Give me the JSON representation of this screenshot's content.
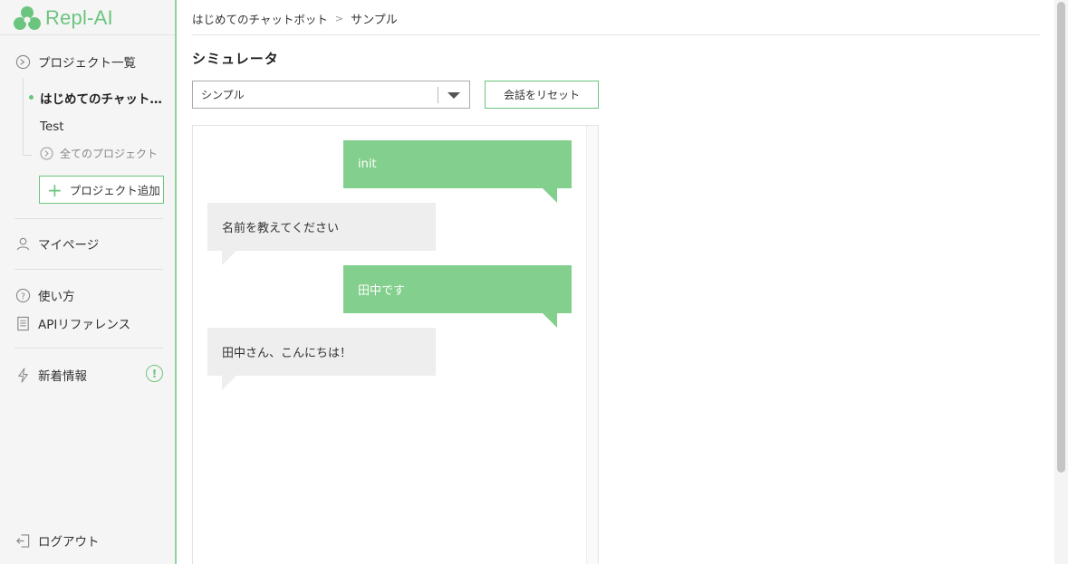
{
  "app": {
    "logo_text": "Repl-AI",
    "accent_color": "#6cc57e"
  },
  "sidebar": {
    "project_list_label": "プロジェクト一覧",
    "projects": [
      {
        "label": "はじめてのチャット…",
        "active": true
      },
      {
        "label": "Test",
        "active": false
      }
    ],
    "all_projects_label": "全てのプロジェクト",
    "add_project_label": "プロジェクト追加",
    "mypage_label": "マイページ",
    "howto_label": "使い方",
    "api_reference_label": "APIリファレンス",
    "news_label": "新着情報",
    "news_alert": "!",
    "logout_label": "ログアウト"
  },
  "breadcrumb": {
    "parent": "はじめてのチャットボット",
    "separator": ">",
    "current": "サンプル"
  },
  "main": {
    "title": "シミュレータ",
    "scenario_select_value": "シンプル",
    "reset_button_label": "会話をリセット"
  },
  "chat": {
    "messages": [
      {
        "from": "user",
        "text": "init"
      },
      {
        "from": "bot",
        "text": "名前を教えてください"
      },
      {
        "from": "user",
        "text": "田中です"
      },
      {
        "from": "bot",
        "text": "田中さん、こんにちは！"
      }
    ]
  }
}
